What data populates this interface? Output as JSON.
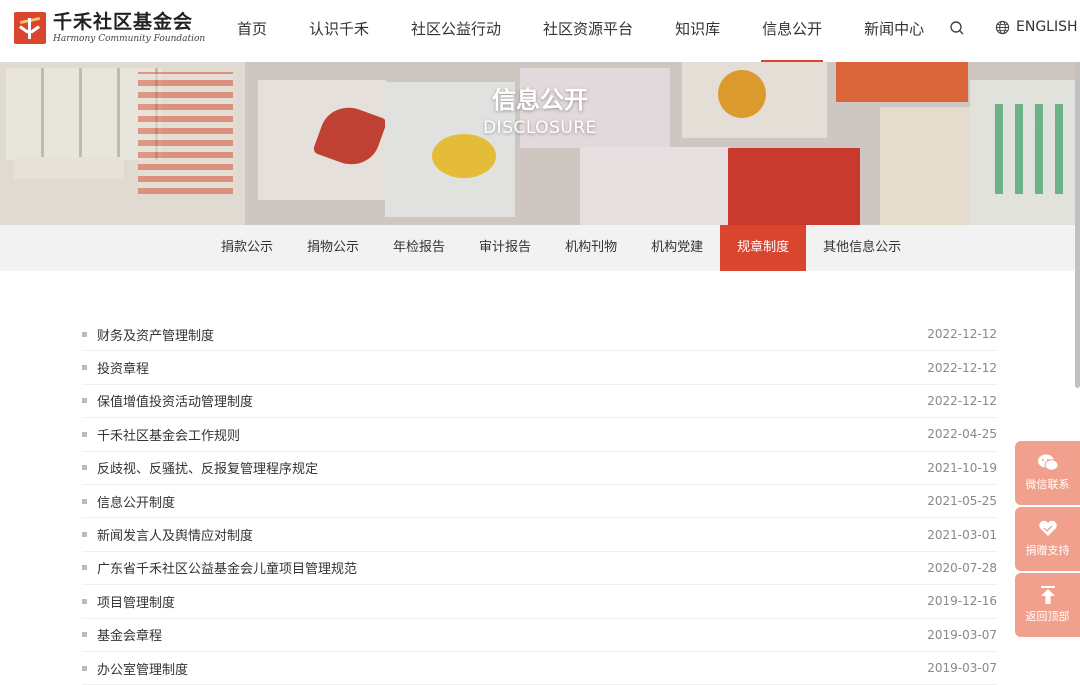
{
  "logo": {
    "name_cn": "千禾社区基金会",
    "name_en": "Harmony Community Foundation"
  },
  "nav": {
    "items": [
      "首页",
      "认识千禾",
      "社区公益行动",
      "社区资源平台",
      "知识库",
      "信息公开",
      "新闻中心"
    ],
    "active": "信息公开",
    "language": "ENGLISH"
  },
  "banner": {
    "title": "信息公开",
    "subtitle": "DISCLOSURE"
  },
  "subnav": {
    "items": [
      "捐款公示",
      "捐物公示",
      "年检报告",
      "审计报告",
      "机构刊物",
      "机构党建",
      "规章制度",
      "其他信息公示"
    ],
    "active": "规章制度"
  },
  "list": [
    {
      "title": "财务及资产管理制度",
      "date": "2022-12-12"
    },
    {
      "title": "投资章程",
      "date": "2022-12-12"
    },
    {
      "title": "保值增值投资活动管理制度",
      "date": "2022-12-12"
    },
    {
      "title": "千禾社区基金会工作规则",
      "date": "2022-04-25"
    },
    {
      "title": "反歧视、反骚扰、反报复管理程序规定",
      "date": "2021-10-19"
    },
    {
      "title": "信息公开制度",
      "date": "2021-05-25"
    },
    {
      "title": "新闻发言人及舆情应对制度",
      "date": "2021-03-01"
    },
    {
      "title": "广东省千禾社区公益基金会儿童项目管理规范",
      "date": "2020-07-28"
    },
    {
      "title": "项目管理制度",
      "date": "2019-12-16"
    },
    {
      "title": "基金会章程",
      "date": "2019-03-07"
    },
    {
      "title": "办公室管理制度",
      "date": "2019-03-07"
    }
  ],
  "floatbar": {
    "wechat": "微信联系",
    "donate": "捐赠支持",
    "top": "返回顶部"
  },
  "colors": {
    "accent": "#d9452f",
    "float_bg": "#f0a08c",
    "subnav_bg": "#f2f2f2"
  }
}
